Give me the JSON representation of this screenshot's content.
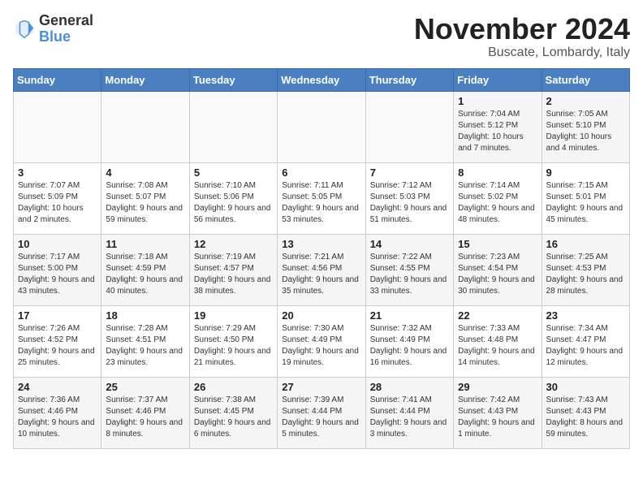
{
  "logo": {
    "general": "General",
    "blue": "Blue"
  },
  "title": {
    "month": "November 2024",
    "location": "Buscate, Lombardy, Italy"
  },
  "weekdays": [
    "Sunday",
    "Monday",
    "Tuesday",
    "Wednesday",
    "Thursday",
    "Friday",
    "Saturday"
  ],
  "weeks": [
    [
      {
        "day": "",
        "info": ""
      },
      {
        "day": "",
        "info": ""
      },
      {
        "day": "",
        "info": ""
      },
      {
        "day": "",
        "info": ""
      },
      {
        "day": "",
        "info": ""
      },
      {
        "day": "1",
        "info": "Sunrise: 7:04 AM\nSunset: 5:12 PM\nDaylight: 10 hours and 7 minutes."
      },
      {
        "day": "2",
        "info": "Sunrise: 7:05 AM\nSunset: 5:10 PM\nDaylight: 10 hours and 4 minutes."
      }
    ],
    [
      {
        "day": "3",
        "info": "Sunrise: 7:07 AM\nSunset: 5:09 PM\nDaylight: 10 hours and 2 minutes."
      },
      {
        "day": "4",
        "info": "Sunrise: 7:08 AM\nSunset: 5:07 PM\nDaylight: 9 hours and 59 minutes."
      },
      {
        "day": "5",
        "info": "Sunrise: 7:10 AM\nSunset: 5:06 PM\nDaylight: 9 hours and 56 minutes."
      },
      {
        "day": "6",
        "info": "Sunrise: 7:11 AM\nSunset: 5:05 PM\nDaylight: 9 hours and 53 minutes."
      },
      {
        "day": "7",
        "info": "Sunrise: 7:12 AM\nSunset: 5:03 PM\nDaylight: 9 hours and 51 minutes."
      },
      {
        "day": "8",
        "info": "Sunrise: 7:14 AM\nSunset: 5:02 PM\nDaylight: 9 hours and 48 minutes."
      },
      {
        "day": "9",
        "info": "Sunrise: 7:15 AM\nSunset: 5:01 PM\nDaylight: 9 hours and 45 minutes."
      }
    ],
    [
      {
        "day": "10",
        "info": "Sunrise: 7:17 AM\nSunset: 5:00 PM\nDaylight: 9 hours and 43 minutes."
      },
      {
        "day": "11",
        "info": "Sunrise: 7:18 AM\nSunset: 4:59 PM\nDaylight: 9 hours and 40 minutes."
      },
      {
        "day": "12",
        "info": "Sunrise: 7:19 AM\nSunset: 4:57 PM\nDaylight: 9 hours and 38 minutes."
      },
      {
        "day": "13",
        "info": "Sunrise: 7:21 AM\nSunset: 4:56 PM\nDaylight: 9 hours and 35 minutes."
      },
      {
        "day": "14",
        "info": "Sunrise: 7:22 AM\nSunset: 4:55 PM\nDaylight: 9 hours and 33 minutes."
      },
      {
        "day": "15",
        "info": "Sunrise: 7:23 AM\nSunset: 4:54 PM\nDaylight: 9 hours and 30 minutes."
      },
      {
        "day": "16",
        "info": "Sunrise: 7:25 AM\nSunset: 4:53 PM\nDaylight: 9 hours and 28 minutes."
      }
    ],
    [
      {
        "day": "17",
        "info": "Sunrise: 7:26 AM\nSunset: 4:52 PM\nDaylight: 9 hours and 25 minutes."
      },
      {
        "day": "18",
        "info": "Sunrise: 7:28 AM\nSunset: 4:51 PM\nDaylight: 9 hours and 23 minutes."
      },
      {
        "day": "19",
        "info": "Sunrise: 7:29 AM\nSunset: 4:50 PM\nDaylight: 9 hours and 21 minutes."
      },
      {
        "day": "20",
        "info": "Sunrise: 7:30 AM\nSunset: 4:49 PM\nDaylight: 9 hours and 19 minutes."
      },
      {
        "day": "21",
        "info": "Sunrise: 7:32 AM\nSunset: 4:49 PM\nDaylight: 9 hours and 16 minutes."
      },
      {
        "day": "22",
        "info": "Sunrise: 7:33 AM\nSunset: 4:48 PM\nDaylight: 9 hours and 14 minutes."
      },
      {
        "day": "23",
        "info": "Sunrise: 7:34 AM\nSunset: 4:47 PM\nDaylight: 9 hours and 12 minutes."
      }
    ],
    [
      {
        "day": "24",
        "info": "Sunrise: 7:36 AM\nSunset: 4:46 PM\nDaylight: 9 hours and 10 minutes."
      },
      {
        "day": "25",
        "info": "Sunrise: 7:37 AM\nSunset: 4:46 PM\nDaylight: 9 hours and 8 minutes."
      },
      {
        "day": "26",
        "info": "Sunrise: 7:38 AM\nSunset: 4:45 PM\nDaylight: 9 hours and 6 minutes."
      },
      {
        "day": "27",
        "info": "Sunrise: 7:39 AM\nSunset: 4:44 PM\nDaylight: 9 hours and 5 minutes."
      },
      {
        "day": "28",
        "info": "Sunrise: 7:41 AM\nSunset: 4:44 PM\nDaylight: 9 hours and 3 minutes."
      },
      {
        "day": "29",
        "info": "Sunrise: 7:42 AM\nSunset: 4:43 PM\nDaylight: 9 hours and 1 minute."
      },
      {
        "day": "30",
        "info": "Sunrise: 7:43 AM\nSunset: 4:43 PM\nDaylight: 8 hours and 59 minutes."
      }
    ]
  ]
}
